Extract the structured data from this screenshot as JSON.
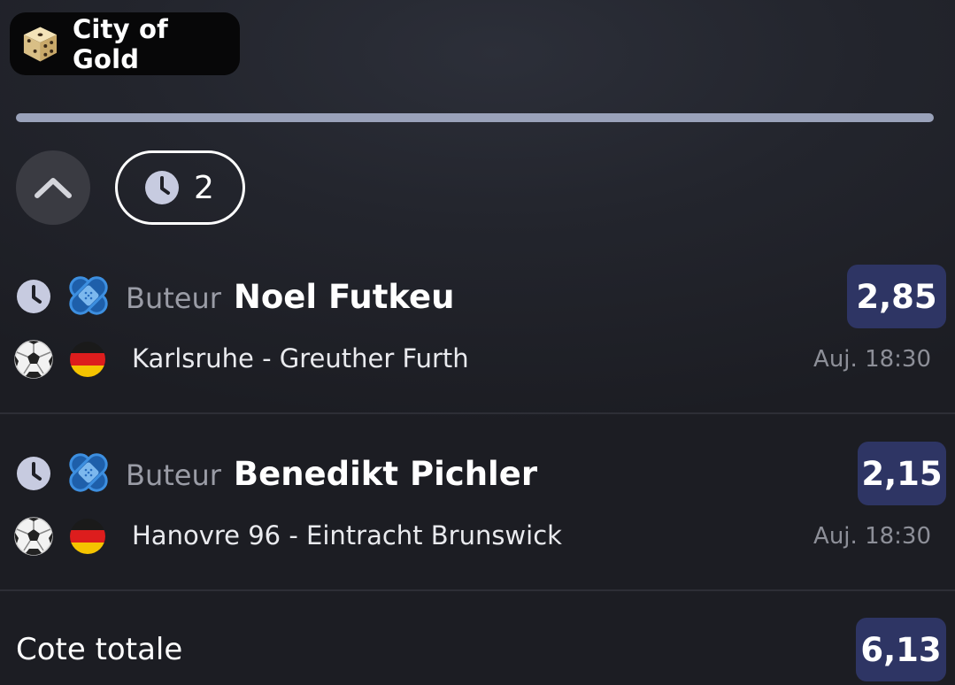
{
  "header": {
    "badge_title": "City of Gold",
    "badge_icon": "dice-icon"
  },
  "controls": {
    "collapse_icon": "chevron-up-icon",
    "pending_icon": "clock-icon",
    "pending_count": "2"
  },
  "bets": [
    {
      "status_icon": "clock-icon",
      "market_icon": "bandage-icon",
      "market": "Buteur",
      "player": "Noel Futkeu",
      "odds": "2,85",
      "sport_icon": "soccer-ball-icon",
      "flag_icon": "germany-flag-icon",
      "match": "Karlsruhe - Greuther Furth",
      "time": "Auj. 18:30"
    },
    {
      "status_icon": "clock-icon",
      "market_icon": "bandage-icon",
      "market": "Buteur",
      "player": "Benedikt Pichler",
      "odds": "2,15",
      "sport_icon": "soccer-ball-icon",
      "flag_icon": "germany-flag-icon",
      "match": "Hanovre 96 - Eintracht Brunswick",
      "time": "Auj. 18:30"
    }
  ],
  "total": {
    "label": "Cote totale",
    "odds": "6,13"
  },
  "colors": {
    "odds_background": "#2e3564",
    "progress_bar": "#9aa2ba",
    "bandage_blue": "#3d8fe0",
    "muted_text": "#8d8f98"
  }
}
